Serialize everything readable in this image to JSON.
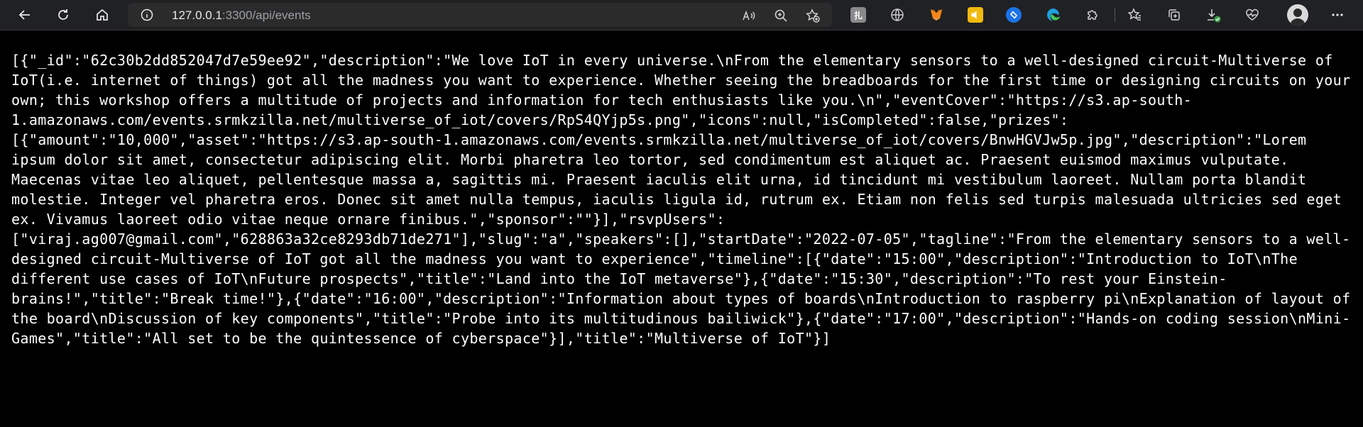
{
  "browser": {
    "url_host": "127.0.0.1",
    "url_rest": ":3300/api/events",
    "icons": [
      "back-icon",
      "refresh-icon",
      "home-icon",
      "site-info-icon",
      "read-aloud-icon",
      "zoom-icon",
      "add-favorite-icon",
      "extension-icon",
      "globe-icon",
      "metamask-icon",
      "notes-icon",
      "shazam-icon",
      "edge-icon",
      "puzzle-icon",
      "favorites-icon",
      "collections-icon",
      "downloads-icon",
      "health-icon",
      "profile-avatar",
      "more-icon"
    ]
  },
  "page": {
    "json_text": "[{\"_id\":\"62c30b2dd852047d7e59ee92\",\"description\":\"We love IoT in every universe.\\nFrom the elementary sensors to a well-designed circuit-Multiverse of IoT(i.e. internet of things) got all the madness you want to experience. Whether seeing the breadboards for the first time or designing circuits on your own; this workshop offers a multitude of projects and information for tech enthusiasts like you.\\n\",\"eventCover\":\"https://s3.ap-south-1.amazonaws.com/events.srmkzilla.net/multiverse_of_iot/covers/RpS4QYjp5s.png\",\"icons\":null,\"isCompleted\":false,\"prizes\":[{\"amount\":\"10,000\",\"asset\":\"https://s3.ap-south-1.amazonaws.com/events.srmkzilla.net/multiverse_of_iot/covers/BnwHGVJw5p.jpg\",\"description\":\"Lorem ipsum dolor sit amet, consectetur adipiscing elit. Morbi pharetra leo tortor, sed condimentum est aliquet ac. Praesent euismod maximus vulputate. Maecenas vitae leo aliquet, pellentesque massa a, sagittis mi. Praesent iaculis elit urna, id tincidunt mi vestibulum laoreet. Nullam porta blandit molestie. Integer vel pharetra eros. Donec sit amet nulla tempus, iaculis ligula id, rutrum ex. Etiam non felis sed turpis malesuada ultricies sed eget ex. Vivamus laoreet odio vitae neque ornare finibus.\",\"sponsor\":\"\"}],\"rsvpUsers\":[\"viraj.ag007@gmail.com\",\"628863a32ce8293db71de271\"],\"slug\":\"a\",\"speakers\":[],\"startDate\":\"2022-07-05\",\"tagline\":\"From the elementary sensors to a well-designed circuit-Multiverse of IoT got all the madness you want to experience\",\"timeline\":[{\"date\":\"15:00\",\"description\":\"Introduction to IoT\\nThe different use cases of IoT\\nFuture prospects\",\"title\":\"Land into the IoT metaverse\"},{\"date\":\"15:30\",\"description\":\"To rest your Einstein-brains!\",\"title\":\"Break time!\"},{\"date\":\"16:00\",\"description\":\"Information about types of boards\\nIntroduction to raspberry pi\\nExplanation of layout of the board\\nDiscussion of key components\",\"title\":\"Probe into its multitudinous bailiwick\"},{\"date\":\"17:00\",\"description\":\"Hands-on coding session\\nMini-Games\",\"title\":\"All set to be the quintessence of cyberspace\"}],\"title\":\"Multiverse of IoT\"}]"
  },
  "colors": {
    "toolbar_bg": "#202124",
    "page_bg": "#000000",
    "text": "#ffffff"
  }
}
